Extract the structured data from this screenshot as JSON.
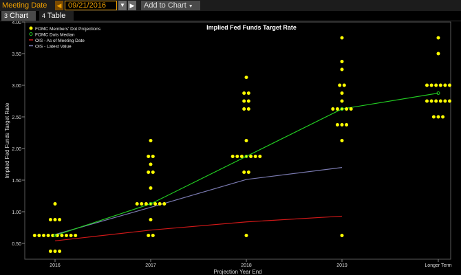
{
  "toolbar": {
    "meeting_date_label": "Meeting Date",
    "date_value": "09/21/2016",
    "add_to_chart_label": "Add to Chart"
  },
  "tabs": [
    {
      "label": "Chart",
      "number": "3"
    },
    {
      "label": "Table",
      "number": "4"
    }
  ],
  "colors": {
    "dots": "#ffff00",
    "median": "#22cc22",
    "ois_meeting": "#d01818",
    "ois_latest": "#7a7ab0",
    "accent": "#f0a000"
  },
  "chart_data": {
    "type": "scatter",
    "title": "Implied Fed Funds Target Rate",
    "xlabel": "Projection Year End",
    "ylabel": "Implied Fed Funds Target Rate",
    "categories": [
      "2016",
      "2017",
      "2018",
      "2019",
      "Longer Term"
    ],
    "ylim": [
      0.25,
      4.0
    ],
    "yticks": [
      "0.50",
      "1.00",
      "1.50",
      "2.00",
      "2.50",
      "3.00",
      "3.50",
      "4.00"
    ],
    "grid": false,
    "legend_position": "top-left",
    "dot_projections": {
      "name": "FOMC Members' Dot Projections",
      "groups": [
        {
          "category": "2016",
          "levels": [
            {
              "rate": 1.125,
              "count": 1
            },
            {
              "rate": 0.875,
              "count": 3
            },
            {
              "rate": 0.625,
              "count": 10
            },
            {
              "rate": 0.375,
              "count": 3
            }
          ]
        },
        {
          "category": "2017",
          "levels": [
            {
              "rate": 2.125,
              "count": 1
            },
            {
              "rate": 1.875,
              "count": 2
            },
            {
              "rate": 1.75,
              "count": 1
            },
            {
              "rate": 1.625,
              "count": 2
            },
            {
              "rate": 1.375,
              "count": 1
            },
            {
              "rate": 1.125,
              "count": 7
            },
            {
              "rate": 0.875,
              "count": 1
            },
            {
              "rate": 0.625,
              "count": 2
            }
          ]
        },
        {
          "category": "2018",
          "levels": [
            {
              "rate": 3.125,
              "count": 1
            },
            {
              "rate": 2.875,
              "count": 2
            },
            {
              "rate": 2.75,
              "count": 2
            },
            {
              "rate": 2.625,
              "count": 2
            },
            {
              "rate": 2.125,
              "count": 1
            },
            {
              "rate": 1.875,
              "count": 7
            },
            {
              "rate": 1.625,
              "count": 2
            },
            {
              "rate": 0.625,
              "count": 1
            }
          ]
        },
        {
          "category": "2019",
          "levels": [
            {
              "rate": 3.75,
              "count": 1
            },
            {
              "rate": 3.375,
              "count": 1
            },
            {
              "rate": 3.25,
              "count": 1
            },
            {
              "rate": 3.0,
              "count": 2
            },
            {
              "rate": 2.875,
              "count": 1
            },
            {
              "rate": 2.75,
              "count": 1
            },
            {
              "rate": 2.625,
              "count": 5
            },
            {
              "rate": 2.375,
              "count": 3
            },
            {
              "rate": 2.125,
              "count": 1
            },
            {
              "rate": 0.625,
              "count": 1
            }
          ]
        },
        {
          "category": "Longer Term",
          "levels": [
            {
              "rate": 3.75,
              "count": 1
            },
            {
              "rate": 3.5,
              "count": 1
            },
            {
              "rate": 3.0,
              "count": 6
            },
            {
              "rate": 2.75,
              "count": 6
            },
            {
              "rate": 2.5,
              "count": 3
            }
          ]
        }
      ]
    },
    "series": [
      {
        "name": "FOMC Dots Median",
        "values": [
          0.625,
          1.125,
          1.875,
          2.625,
          2.875
        ]
      },
      {
        "name": "OIS - As of Meeting Date",
        "values": [
          0.54,
          0.71,
          0.84,
          0.93,
          null
        ]
      },
      {
        "name": "OIS - Latest Value",
        "values": [
          0.64,
          1.07,
          1.51,
          1.7,
          null
        ]
      }
    ]
  }
}
